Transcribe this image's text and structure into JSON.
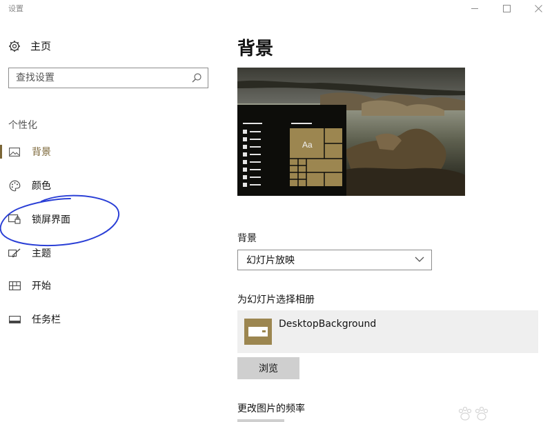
{
  "window": {
    "title": "设置",
    "controls": [
      "minimize",
      "maximize",
      "close"
    ]
  },
  "sidebar": {
    "home_label": "主页",
    "search": {
      "placeholder": "查找设置"
    },
    "section_label": "个性化",
    "items": [
      {
        "label": "背景",
        "icon": "picture-icon",
        "active": true
      },
      {
        "label": "颜色",
        "icon": "palette-icon",
        "active": false
      },
      {
        "label": "锁屏界面",
        "icon": "lock-screen-icon",
        "active": false
      },
      {
        "label": "主题",
        "icon": "brush-icon",
        "active": false
      },
      {
        "label": "开始",
        "icon": "start-grid-icon",
        "active": false
      },
      {
        "label": "任务栏",
        "icon": "taskbar-icon",
        "active": false
      }
    ]
  },
  "main": {
    "title": "背景",
    "background_label": "背景",
    "background_select_value": "幻灯片放映",
    "album_label": "为幻灯片选择相册",
    "album_name": "DesktopBackground",
    "browse_label": "浏览",
    "frequency_label": "更改图片的频率",
    "preview_tile_text": "Aa"
  },
  "colors": {
    "accent": "#7a6536",
    "tile": "#9c8650",
    "annotation": "#2a3fd6"
  }
}
